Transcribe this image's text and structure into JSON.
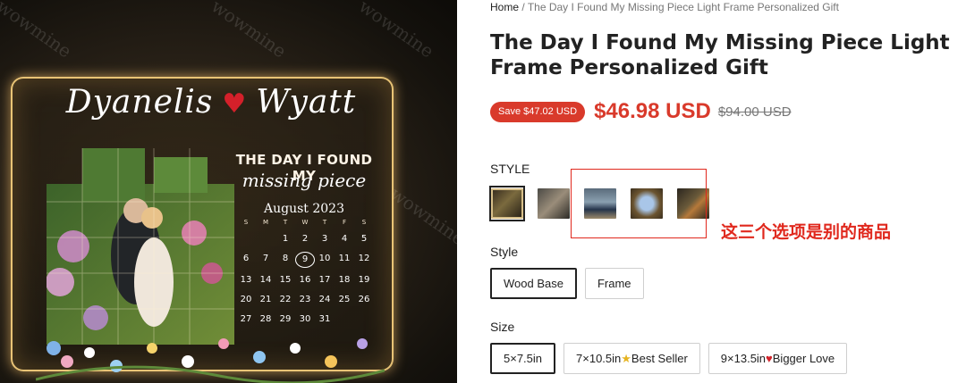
{
  "image": {
    "names_left": "Dyanelis",
    "names_right": "Wyatt",
    "heading": "THE DAY I FOUND MY",
    "script_line": "missing piece",
    "calendar": {
      "month": "August 2023",
      "weekdays": [
        "S",
        "M",
        "T",
        "W",
        "T",
        "F",
        "S"
      ],
      "weeks": [
        [
          "",
          "",
          "1",
          "2",
          "3",
          "4",
          "5"
        ],
        [
          "6",
          "7",
          "8",
          "9",
          "10",
          "11",
          "12"
        ],
        [
          "13",
          "14",
          "15",
          "16",
          "17",
          "18",
          "19"
        ],
        [
          "20",
          "21",
          "22",
          "23",
          "24",
          "25",
          "26"
        ],
        [
          "27",
          "28",
          "29",
          "30",
          "31",
          "",
          ""
        ]
      ],
      "marked_day": "9"
    },
    "watermark": "wowmine"
  },
  "breadcrumb": {
    "home": "Home",
    "separator": " / ",
    "current": "The Day I Found My Missing Piece Light Frame Personalized Gift"
  },
  "product": {
    "title": "The Day I Found My Missing Piece Light Frame Personalized Gift",
    "save_badge": "Save $47.02 USD",
    "price": "$46.98 USD",
    "compare_price": "$94.00 USD"
  },
  "style_swatches": {
    "label": "STYLE",
    "items": [
      {
        "name": "swatch-1",
        "selected": true
      },
      {
        "name": "swatch-2",
        "selected": false
      },
      {
        "name": "swatch-3",
        "selected": false
      },
      {
        "name": "swatch-4",
        "selected": false
      },
      {
        "name": "swatch-5",
        "selected": false
      }
    ]
  },
  "style_option": {
    "label": "Style",
    "options": [
      "Wood Base",
      "Frame"
    ],
    "selected": "Wood Base"
  },
  "size_option": {
    "label": "Size",
    "options": [
      {
        "text": "5×7.5in",
        "suffix": "",
        "icon": ""
      },
      {
        "text": "7×10.5in",
        "suffix": "Best Seller",
        "icon": "star-icon"
      },
      {
        "text": "9×13.5in",
        "suffix": "Bigger Love",
        "icon": "heart-icon"
      }
    ],
    "selected": "5×7.5in"
  },
  "annotation": {
    "text": "这三个选项是别的商品"
  },
  "colors": {
    "accent_red": "#d93a2b",
    "annotation_red": "#e0281d",
    "selected_border": "#222222"
  }
}
